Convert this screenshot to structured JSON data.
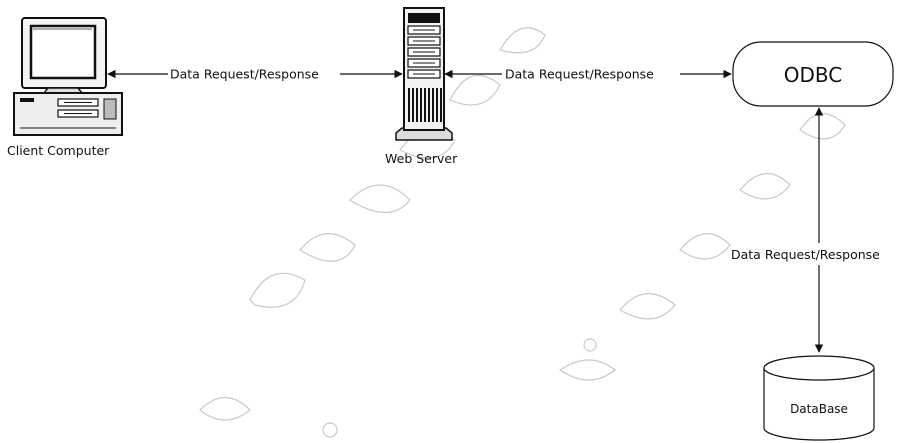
{
  "nodes": {
    "client": {
      "label": "Client Computer",
      "icon": "desktop-computer-icon"
    },
    "web_server": {
      "label": "Web Server",
      "icon": "tower-server-icon"
    },
    "odbc": {
      "label": "ODBC"
    },
    "database": {
      "label": "DataBase",
      "icon": "database-cylinder-icon"
    }
  },
  "edges": [
    {
      "from": "client",
      "to": "web_server",
      "label": "Data Request/Response",
      "bidirectional": true
    },
    {
      "from": "web_server",
      "to": "odbc",
      "label": "Data Request/Response",
      "bidirectional": true
    },
    {
      "from": "odbc",
      "to": "database",
      "label": "Data Request/Response",
      "bidirectional": true
    }
  ],
  "colors": {
    "ink": "#111111",
    "background": "#ffffff",
    "watermark": "#c9c9c9"
  }
}
